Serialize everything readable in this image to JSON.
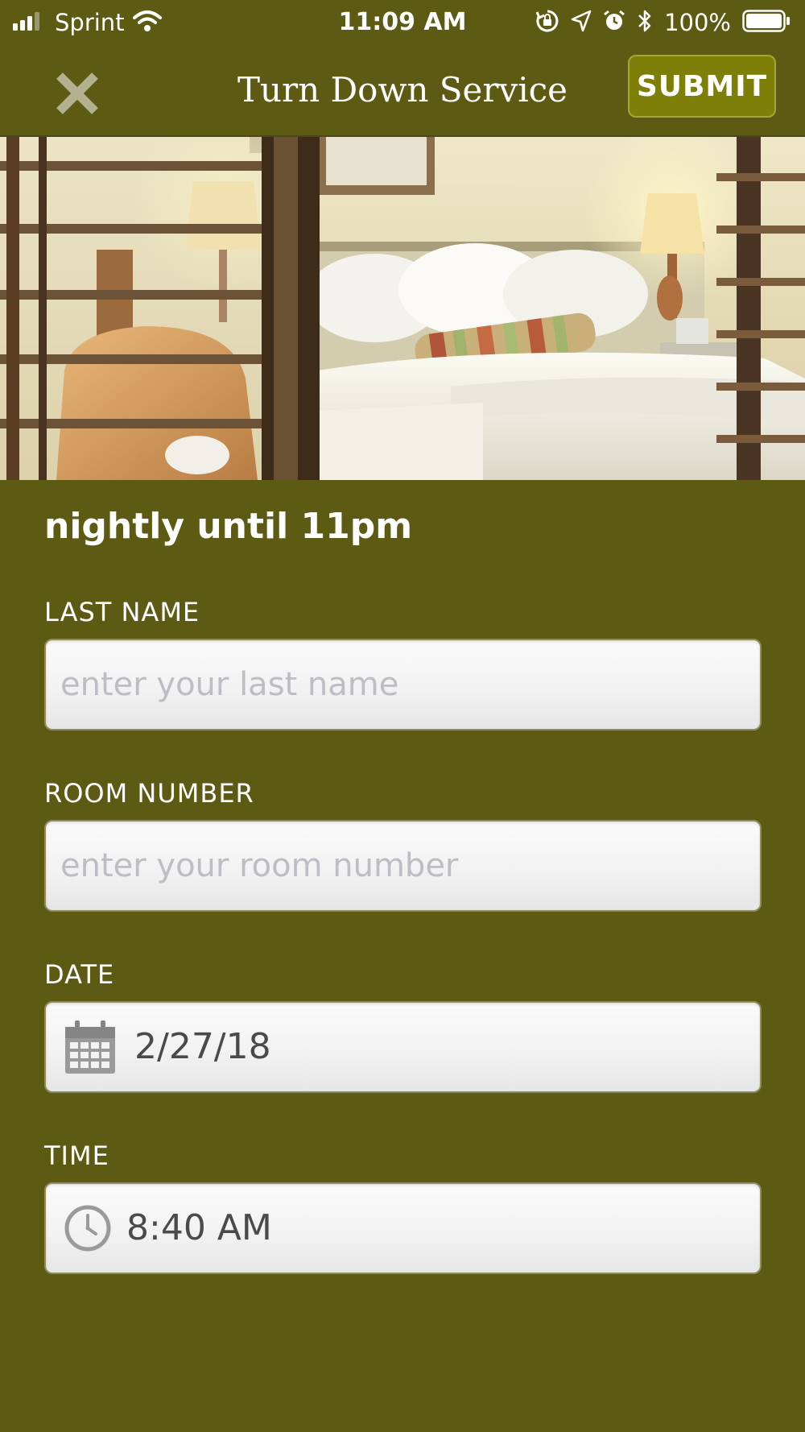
{
  "status_bar": {
    "carrier": "Sprint",
    "time": "11:09 AM",
    "battery_percent": "100%",
    "icons": [
      "signal-icon",
      "wifi-icon",
      "rotation-lock-icon",
      "location-icon",
      "alarm-icon",
      "bluetooth-icon",
      "battery-icon"
    ]
  },
  "nav": {
    "title": "Turn Down Service",
    "submit_label": "SUBMIT",
    "close_icon": "close-icon"
  },
  "hero": {
    "image": "hotel-room-photo"
  },
  "form": {
    "subtitle": "nightly until 11pm",
    "last_name": {
      "label": "LAST NAME",
      "placeholder": "enter your last name",
      "value": ""
    },
    "room_number": {
      "label": "ROOM NUMBER",
      "placeholder": "enter your room number",
      "value": ""
    },
    "date": {
      "label": "DATE",
      "value": "2/27/18",
      "icon": "calendar-icon"
    },
    "time": {
      "label": "TIME",
      "value": "8:40 AM",
      "icon": "clock-icon"
    }
  },
  "colors": {
    "background": "#5c5a13",
    "submit_button": "#7d7f08",
    "field_background": "#f1f1f1",
    "placeholder": "#bdbdc4"
  }
}
